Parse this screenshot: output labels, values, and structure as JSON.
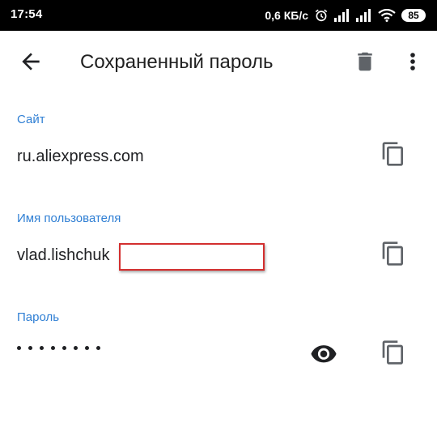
{
  "status_bar": {
    "time": "17:54",
    "net_speed": "0,6 КБ/с",
    "battery": "85",
    "icons": [
      "alarm-icon",
      "signal-icon",
      "signal-icon",
      "wifi-icon",
      "battery-icon"
    ]
  },
  "app_bar": {
    "title": "Сохраненный пароль",
    "back_icon": "arrow-back-icon",
    "delete_icon": "trash-icon",
    "menu_icon": "more-vert-icon"
  },
  "site": {
    "label": "Сайт",
    "value": "ru.aliexpress.com"
  },
  "username": {
    "label": "Имя пользователя",
    "value": "vlad.lishchuk"
  },
  "password": {
    "label": "Пароль",
    "masked_length": 8
  },
  "colors": {
    "accent": "#2f7fd4",
    "text": "#202124",
    "icon": "#5f6368",
    "highlight_box": "#d32f2f"
  }
}
